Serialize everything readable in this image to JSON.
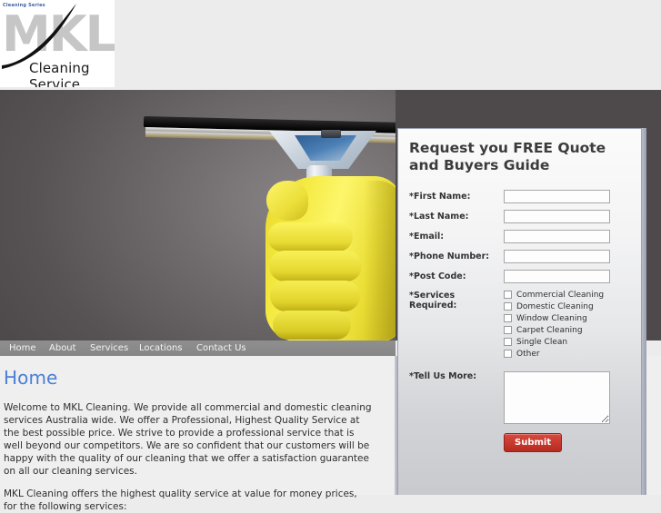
{
  "site": {
    "logo_tagline": "Cleaning Series",
    "logo_mark": "MKL",
    "logo_subtitle": "Cleaning Service"
  },
  "nav": {
    "items": [
      {
        "label": "Home"
      },
      {
        "label": "About"
      },
      {
        "label": "Services"
      },
      {
        "label": "Locations"
      },
      {
        "label": "Contact Us"
      }
    ]
  },
  "main": {
    "page_title": "Home",
    "paragraph1": "Welcome to MKL Cleaning. We provide all commercial and domestic cleaning services Australia wide. We offer a Professional, Highest Quality Service at the best possible price. We strive to provide a professional service that is well beyond our competitors. We are so confident that our customers will be happy with the quality of our cleaning that we offer a satisfaction guarantee on all our cleaning services.",
    "paragraph2": "MKL Cleaning offers the highest quality service at value for money prices, for the following services:"
  },
  "quote_form": {
    "title": "Request you FREE Quote and Buyers Guide",
    "fields": [
      {
        "label": "*First Name:",
        "value": "",
        "placeholder": ""
      },
      {
        "label": "*Last Name:",
        "value": "",
        "placeholder": ""
      },
      {
        "label": "*Email:",
        "value": "",
        "placeholder": ""
      },
      {
        "label": "*Phone Number:",
        "value": "",
        "placeholder": ""
      },
      {
        "label": "*Post Code:",
        "value": "",
        "placeholder": ""
      }
    ],
    "services_label": "*Services Required:",
    "services": [
      {
        "label": "Commercial Cleaning",
        "checked": false
      },
      {
        "label": "Domestic Cleaning",
        "checked": false
      },
      {
        "label": "Window Cleaning",
        "checked": false
      },
      {
        "label": "Carpet Cleaning",
        "checked": false
      },
      {
        "label": "Single Clean",
        "checked": false
      },
      {
        "label": "Other",
        "checked": false
      }
    ],
    "message_label": "*Tell Us More:",
    "message_value": "",
    "message_placeholder": "",
    "submit_label": "Submit"
  },
  "colors": {
    "accent_blue": "#4a7fd6",
    "submit_red": "#c9342c",
    "nav_grey": "#8a8a8a",
    "hero_dark": "#4b4749",
    "panel_light": "#f4f4f5"
  }
}
